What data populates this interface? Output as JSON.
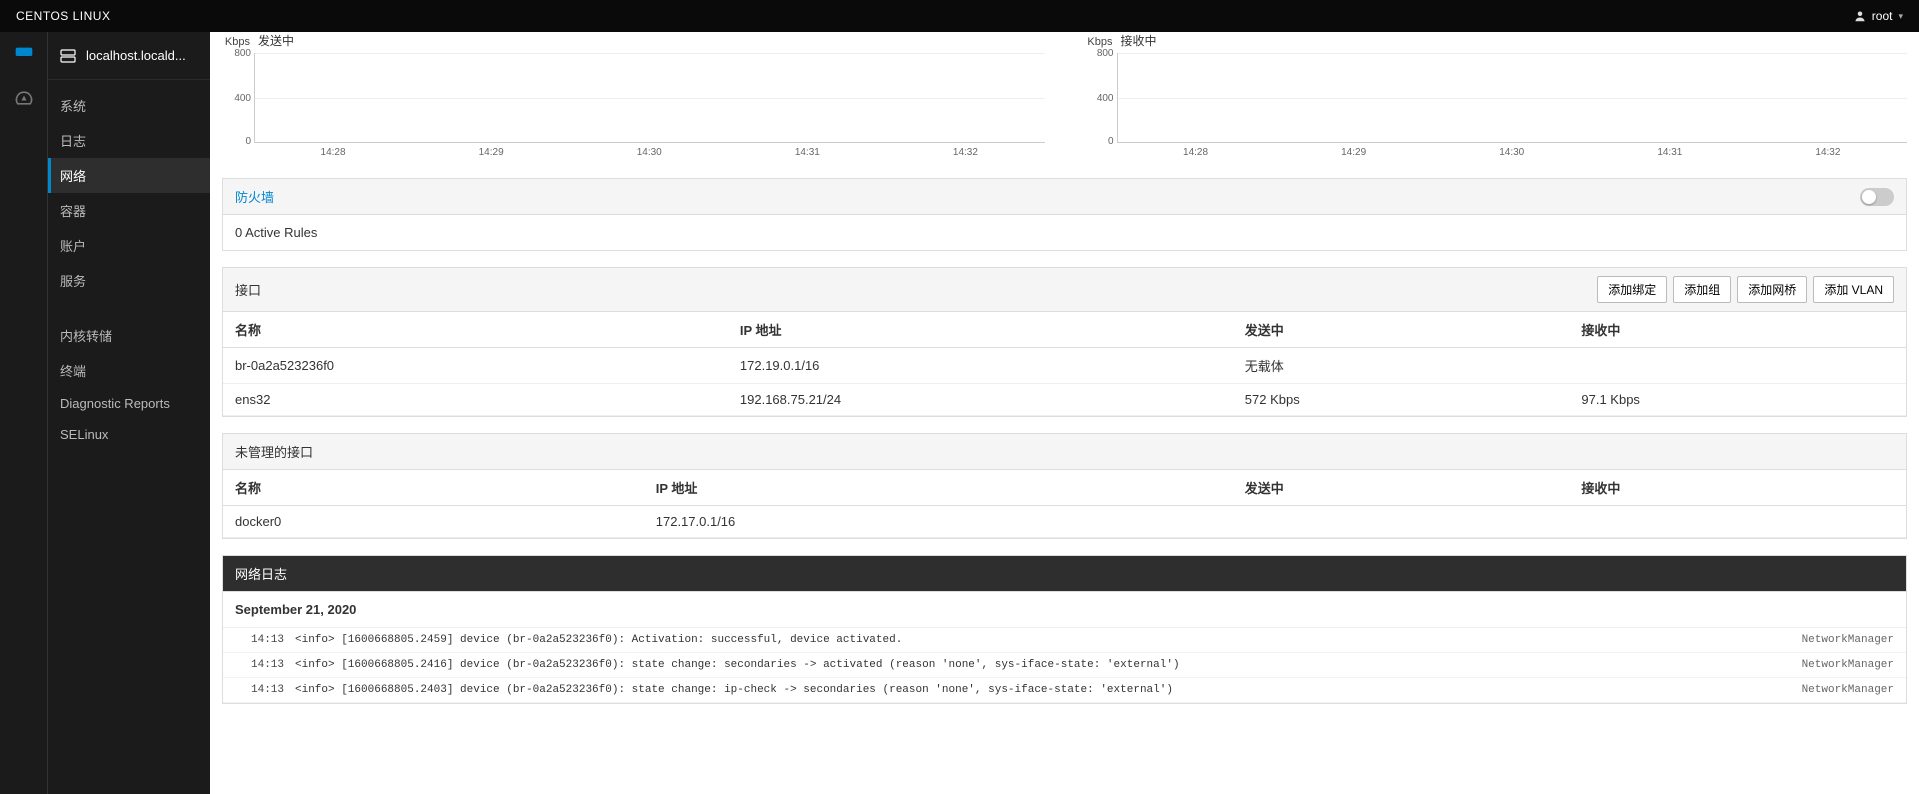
{
  "topbar": {
    "brand": "CENTOS LINUX",
    "user": "root"
  },
  "host": "localhost.locald...",
  "sidebar": {
    "items": [
      {
        "label": "系统"
      },
      {
        "label": "日志"
      },
      {
        "label": "网络",
        "active": true
      },
      {
        "label": "容器"
      },
      {
        "label": "账户"
      },
      {
        "label": "服务"
      }
    ],
    "tools": [
      {
        "label": "内核转储"
      },
      {
        "label": "终端"
      },
      {
        "label": "Diagnostic Reports"
      },
      {
        "label": "SELinux"
      }
    ]
  },
  "charts": {
    "unit": "Kbps",
    "send_title": "发送中",
    "recv_title": "接收中",
    "yticks": [
      "800",
      "400",
      "0"
    ],
    "xticks": [
      "14:28",
      "14:29",
      "14:30",
      "14:31",
      "14:32"
    ]
  },
  "chart_data": [
    {
      "type": "line",
      "title": "发送中",
      "xlabel": "",
      "ylabel": "Kbps",
      "ylim": [
        0,
        800
      ],
      "x": [
        "14:28",
        "14:29",
        "14:30",
        "14:31",
        "14:32"
      ],
      "series": [
        {
          "name": "发送中",
          "values": [
            0,
            0,
            0,
            0,
            0
          ]
        }
      ]
    },
    {
      "type": "line",
      "title": "接收中",
      "xlabel": "",
      "ylabel": "Kbps",
      "ylim": [
        0,
        800
      ],
      "x": [
        "14:28",
        "14:29",
        "14:30",
        "14:31",
        "14:32"
      ],
      "series": [
        {
          "name": "接收中",
          "values": [
            0,
            0,
            0,
            0,
            0
          ]
        }
      ]
    }
  ],
  "firewall": {
    "link": "防火墙",
    "status": "0 Active Rules"
  },
  "interfaces": {
    "title": "接口",
    "buttons": {
      "bond": "添加绑定",
      "team": "添加组",
      "bridge": "添加网桥",
      "vlan": "添加 VLAN"
    },
    "headers": {
      "name": "名称",
      "ip": "IP 地址",
      "send": "发送中",
      "recv": "接收中"
    },
    "rows": [
      {
        "name": "br-0a2a523236f0",
        "ip": "172.19.0.1/16",
        "send": "无载体",
        "recv": ""
      },
      {
        "name": "ens32",
        "ip": "192.168.75.21/24",
        "send": "572 Kbps",
        "recv": "97.1 Kbps"
      }
    ]
  },
  "unmanaged": {
    "title": "未管理的接口",
    "headers": {
      "name": "名称",
      "ip": "IP 地址",
      "send": "发送中",
      "recv": "接收中"
    },
    "rows": [
      {
        "name": "docker0",
        "ip": "172.17.0.1/16",
        "send": "",
        "recv": ""
      }
    ]
  },
  "logs": {
    "title": "网络日志",
    "date": "September 21, 2020",
    "entries": [
      {
        "time": "14:13",
        "msg": "<info>  [1600668805.2459] device (br-0a2a523236f0): Activation: successful, device activated.",
        "src": "NetworkManager"
      },
      {
        "time": "14:13",
        "msg": "<info>  [1600668805.2416] device (br-0a2a523236f0): state change: secondaries -> activated (reason 'none', sys-iface-state: 'external')",
        "src": "NetworkManager"
      },
      {
        "time": "14:13",
        "msg": "<info>  [1600668805.2403] device (br-0a2a523236f0): state change: ip-check -> secondaries (reason 'none', sys-iface-state: 'external')",
        "src": "NetworkManager"
      }
    ]
  }
}
